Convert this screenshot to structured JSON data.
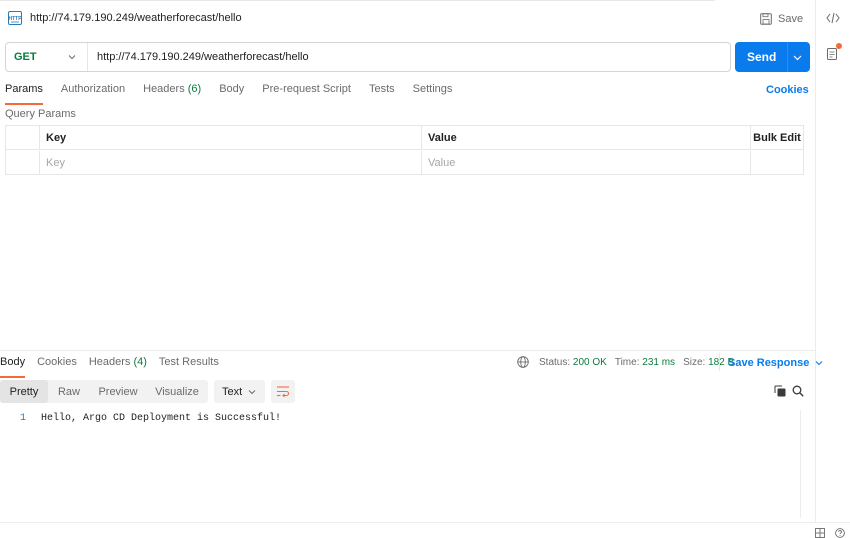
{
  "request": {
    "title": "http://74.179.190.249/weatherforecast/hello",
    "save_label": "Save",
    "method": "GET",
    "url": "http://74.179.190.249/weatherforecast/hello",
    "send_label": "Send"
  },
  "request_tabs": [
    {
      "label": "Params",
      "active": true
    },
    {
      "label": "Authorization"
    },
    {
      "label": "Headers ",
      "count": "(6)"
    },
    {
      "label": "Body"
    },
    {
      "label": "Pre-request Script"
    },
    {
      "label": "Tests"
    },
    {
      "label": "Settings"
    }
  ],
  "cookies_label": "Cookies",
  "params": {
    "section_label": "Query Params",
    "columns": [
      "Key",
      "Value",
      "Bulk Edit"
    ],
    "placeholders": {
      "key": "Key",
      "value": "Value"
    }
  },
  "response": {
    "tabs": [
      {
        "label": "Body",
        "active": true
      },
      {
        "label": "Cookies"
      },
      {
        "label": "Headers ",
        "count": "(4)"
      },
      {
        "label": "Test Results"
      }
    ],
    "status_label": "Status:",
    "status_value": "200 OK",
    "time_label": "Time:",
    "time_value": "231 ms",
    "size_label": "Size:",
    "size_value": "182 B",
    "save_response_label": "Save Response",
    "views": [
      "Pretty",
      "Raw",
      "Preview",
      "Visualize"
    ],
    "format": "Text",
    "body_lines": [
      {
        "no": "1",
        "text": "Hello, Argo CD Deployment is Successful!"
      }
    ]
  },
  "icons": {
    "http": "http-file-icon",
    "save": "save-icon",
    "code": "code-icon",
    "doc": "documentation-icon",
    "globe": "globe-icon",
    "copy": "copy-icon",
    "search": "search-icon",
    "wrap": "wrap-lines-icon"
  },
  "colors": {
    "accent": "#097bed",
    "method_green": "#0a7d3e",
    "tab_underline": "#f26b3a"
  }
}
